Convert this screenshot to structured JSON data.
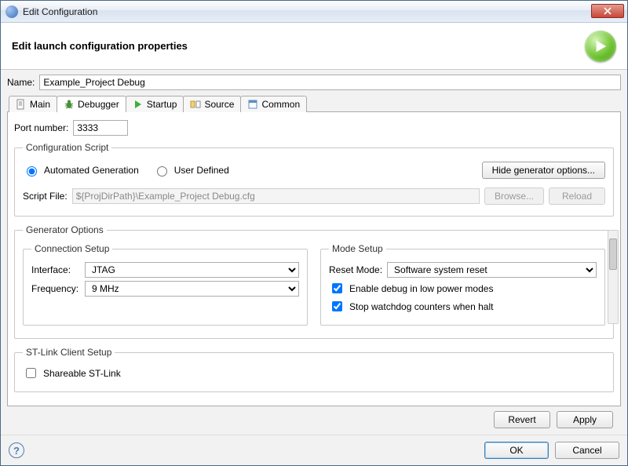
{
  "window": {
    "title": "Edit Configuration"
  },
  "header": {
    "title": "Edit launch configuration properties"
  },
  "nameRow": {
    "label": "Name:",
    "value": "Example_Project Debug"
  },
  "tabs": {
    "items": [
      {
        "label": "Main"
      },
      {
        "label": "Debugger"
      },
      {
        "label": "Startup"
      },
      {
        "label": "Source"
      },
      {
        "label": "Common"
      }
    ]
  },
  "port": {
    "label": "Port number:",
    "value": "3333"
  },
  "configScript": {
    "legend": "Configuration Script",
    "radios": {
      "auto": "Automated Generation",
      "user": "User Defined"
    },
    "hideBtn": "Hide generator options...",
    "scriptFileLabel": "Script File:",
    "scriptFileValue": "${ProjDirPath}\\Example_Project Debug.cfg",
    "browse": "Browse...",
    "reload": "Reload"
  },
  "genOptions": {
    "legend": "Generator Options",
    "conn": {
      "legend": "Connection Setup",
      "ifaceLabel": "Interface:",
      "ifaceValue": "JTAG",
      "freqLabel": "Frequency:",
      "freqValue": "9 MHz"
    },
    "mode": {
      "legend": "Mode Setup",
      "resetLabel": "Reset Mode:",
      "resetValue": "Software system reset",
      "lowPower": "Enable debug in low power modes",
      "watchdog": "Stop watchdog counters when halt"
    }
  },
  "stlink": {
    "legend": "ST-Link Client Setup",
    "shareable": "Shareable ST-Link"
  },
  "buttons": {
    "revert": "Revert",
    "apply": "Apply",
    "ok": "OK",
    "cancel": "Cancel"
  }
}
